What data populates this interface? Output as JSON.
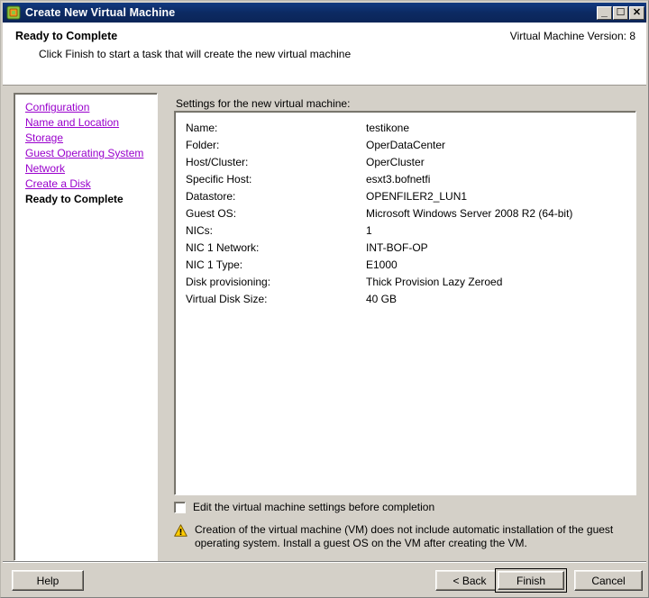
{
  "window": {
    "title": "Create New Virtual Machine",
    "icon": "virtual-machine-icon",
    "controls": {
      "minimize": "_",
      "maximize": "☐",
      "close": "✕"
    }
  },
  "header": {
    "title": "Ready to Complete",
    "subtitle": "Click Finish to start a task that will create the new virtual machine",
    "version_label": "Virtual Machine Version: 8"
  },
  "nav": {
    "items": [
      {
        "label": "Configuration",
        "state": "link"
      },
      {
        "label": "Name and Location",
        "state": "link"
      },
      {
        "label": "Storage",
        "state": "link"
      },
      {
        "label": "Guest Operating System",
        "state": "link"
      },
      {
        "label": "Network",
        "state": "link"
      },
      {
        "label": "Create a Disk",
        "state": "link"
      },
      {
        "label": "Ready to Complete",
        "state": "current"
      }
    ]
  },
  "settings": {
    "heading": "Settings for the new virtual machine:",
    "rows": [
      {
        "label": "Name:",
        "value": "testikone"
      },
      {
        "label": "Folder:",
        "value": "OperDataCenter"
      },
      {
        "label": "Host/Cluster:",
        "value": "OperCluster"
      },
      {
        "label": "Specific Host:",
        "value": "esxt3.bofnetfi"
      },
      {
        "label": "Datastore:",
        "value": "OPENFILER2_LUN1"
      },
      {
        "label": "Guest OS:",
        "value": "Microsoft Windows Server 2008 R2 (64-bit)"
      },
      {
        "label": "NICs:",
        "value": "1"
      },
      {
        "label": "NIC 1 Network:",
        "value": "INT-BOF-OP"
      },
      {
        "label": "NIC 1 Type:",
        "value": "E1000"
      },
      {
        "label": "Disk provisioning:",
        "value": "Thick Provision Lazy Zeroed"
      },
      {
        "label": "Virtual Disk Size:",
        "value": "40 GB"
      }
    ]
  },
  "options": {
    "edit_before_completion_label": "Edit the virtual machine settings before completion",
    "edit_before_completion_checked": false
  },
  "warning": {
    "icon": "warning-triangle-icon",
    "text": "Creation of the virtual machine (VM) does not include automatic installation of the guest operating system. Install a guest OS on the VM after creating the VM."
  },
  "footer": {
    "help_label": "Help",
    "back_label": "< Back",
    "finish_label": "Finish",
    "cancel_label": "Cancel"
  },
  "colors": {
    "titlebar": "#0c2a63",
    "dialog_face": "#d4d0c8",
    "link": "#9900cc",
    "warning": "#ffcc00"
  }
}
